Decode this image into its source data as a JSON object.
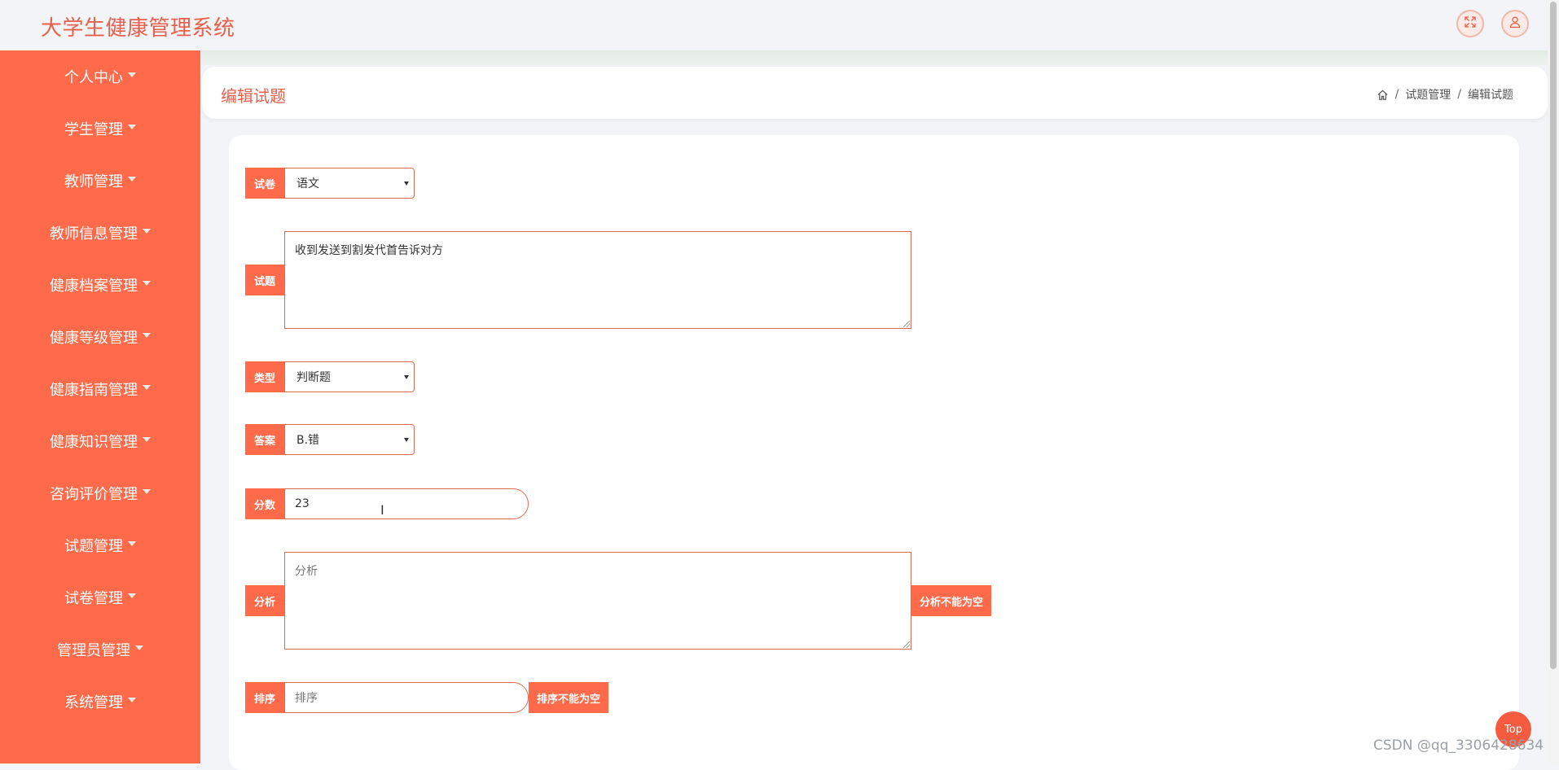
{
  "app": {
    "title": "大学生健康管理系统"
  },
  "sidebar": {
    "items": [
      {
        "label": "个人中心"
      },
      {
        "label": "学生管理"
      },
      {
        "label": "教师管理"
      },
      {
        "label": "教师信息管理"
      },
      {
        "label": "健康档案管理"
      },
      {
        "label": "健康等级管理"
      },
      {
        "label": "健康指南管理"
      },
      {
        "label": "健康知识管理"
      },
      {
        "label": "咨询评价管理"
      },
      {
        "label": "试题管理"
      },
      {
        "label": "试卷管理"
      },
      {
        "label": "管理员管理"
      },
      {
        "label": "系统管理"
      }
    ]
  },
  "header": {
    "page_title": "编辑试题",
    "breadcrumb": [
      "试题管理",
      "编辑试题"
    ],
    "breadcrumb_sep": "/"
  },
  "form": {
    "paper": {
      "label": "试卷",
      "value": "语文"
    },
    "question": {
      "label": "试题",
      "value": "收到发送到割发代首告诉对方"
    },
    "type": {
      "label": "类型",
      "value": "判断题"
    },
    "answer": {
      "label": "答案",
      "value": "B.错"
    },
    "score": {
      "label": "分数",
      "value": "23"
    },
    "analysis": {
      "label": "分析",
      "placeholder": "分析",
      "error": "分析不能为空"
    },
    "sort": {
      "label": "排序",
      "placeholder": "排序",
      "error": "排序不能为空"
    }
  },
  "top_button": {
    "label": "Top"
  },
  "watermark": "CSDN @qq_3306428634",
  "colors": {
    "brand": "#fe6a4a",
    "title": "#e8604c"
  },
  "icons": [
    "fullscreen-icon",
    "user-icon",
    "home-icon"
  ]
}
